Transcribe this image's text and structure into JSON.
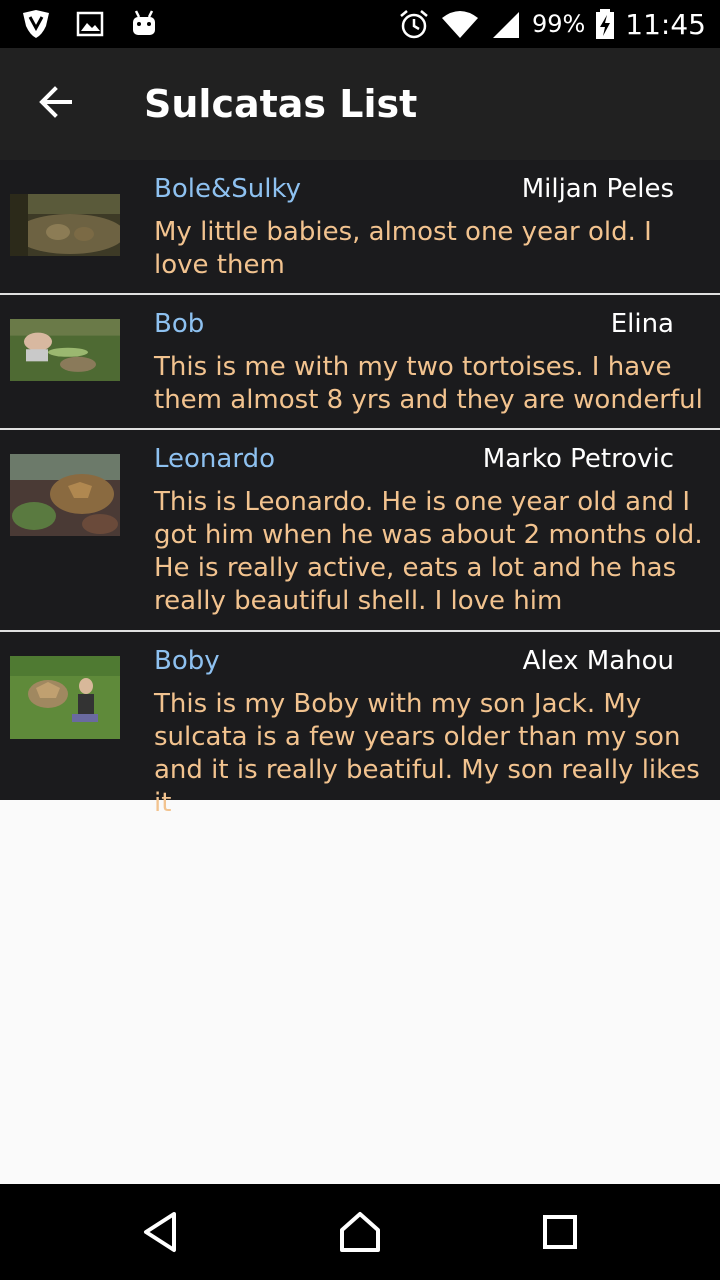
{
  "status_bar": {
    "icons": [
      "shield-icon",
      "image-icon",
      "android-icon",
      "alarm-icon",
      "wifi-icon",
      "signal-icon",
      "battery-charging-icon"
    ],
    "battery": "99%",
    "time": "11:45"
  },
  "app_bar": {
    "back_icon": "arrow-back-icon",
    "title": "Sulcatas List"
  },
  "items": [
    {
      "name": "Bole&Sulky",
      "owner": "Miljan Peles",
      "description": "My little babies, almost one year old. I love them"
    },
    {
      "name": "Bob",
      "owner": "Elina",
      "description": "This is me with my two tortoises. I have them almost 8 yrs and they are wonderful"
    },
    {
      "name": "Leonardo",
      "owner": "Marko Petrovic",
      "description": "This is Leonardo. He is one year old and I got him when he was about 2 months old. He is really active, eats a lot and he has really beautiful shell. I love him"
    },
    {
      "name": "Boby",
      "owner": "Alex Mahou",
      "description": "This is my Boby with my son Jack. My sulcata is a few years older than my son and it is really beatiful. My son really likes it"
    }
  ],
  "nav_bar": {
    "icons": [
      "back-triangle-icon",
      "home-icon",
      "recents-icon"
    ]
  },
  "colors": {
    "app_bar": "#212121",
    "list_bg": "#1b1b1d",
    "name": "#8ec1f0",
    "owner": "#ffffff",
    "description": "#f2c38f",
    "divider": "#e0e0e0",
    "empty_area": "#fafafa"
  }
}
